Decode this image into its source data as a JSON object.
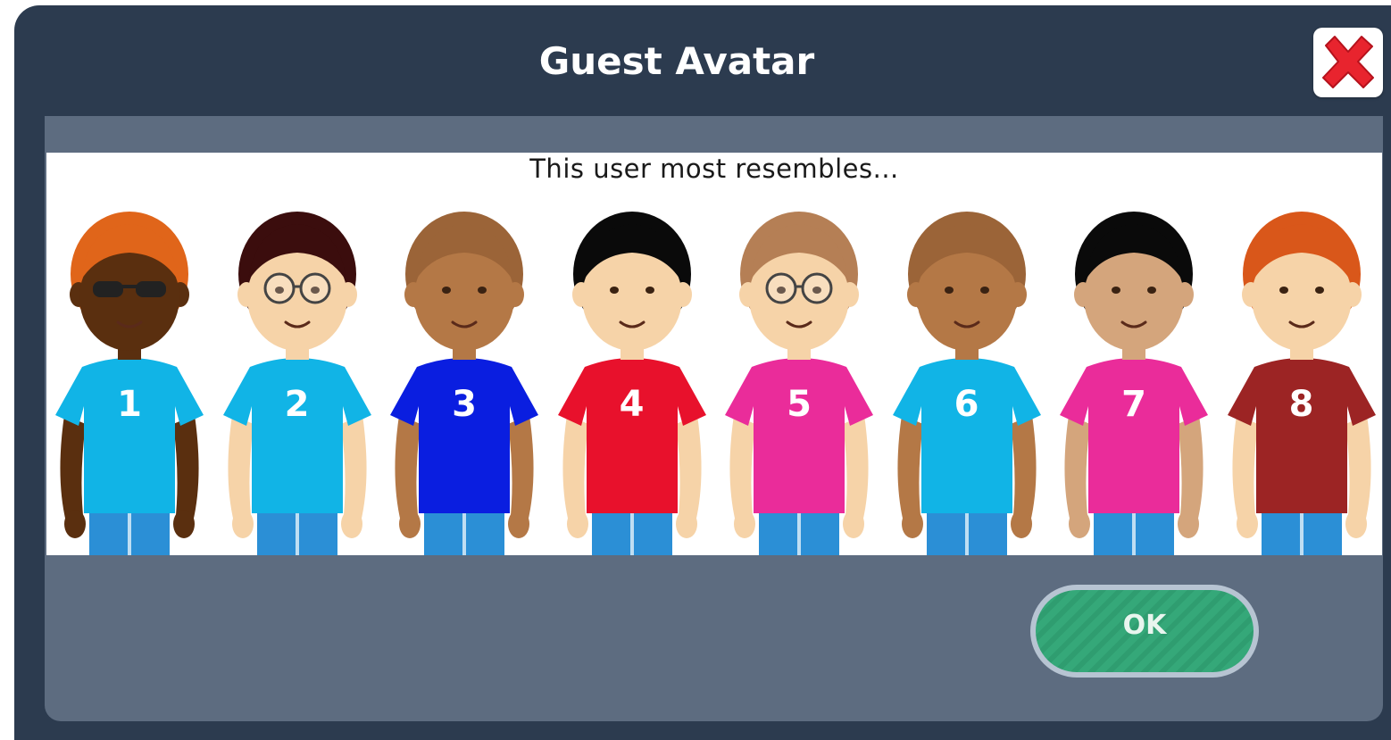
{
  "dialog": {
    "title": "Guest Avatar",
    "close_icon": "close-x-icon"
  },
  "prompt": "This user most resembles...",
  "avatars": [
    {
      "number": "1",
      "shirt": "#11b4e6",
      "skin": "#5a2f0f",
      "hair": "#e0651a",
      "glasses": "sunglasses"
    },
    {
      "number": "2",
      "shirt": "#11b4e6",
      "skin": "#f6d3a8",
      "hair": "#3b0d0d",
      "glasses": "round"
    },
    {
      "number": "3",
      "shirt": "#0a1ee0",
      "skin": "#b47846",
      "hair": "#9b6438",
      "glasses": "none"
    },
    {
      "number": "4",
      "shirt": "#e8112c",
      "skin": "#f6d3a8",
      "hair": "#0a0a0a",
      "glasses": "none"
    },
    {
      "number": "5",
      "shirt": "#ea2c9a",
      "skin": "#f6d3a8",
      "hair": "#b57f55",
      "glasses": "round"
    },
    {
      "number": "6",
      "shirt": "#11b4e6",
      "skin": "#b47846",
      "hair": "#9b6438",
      "glasses": "none"
    },
    {
      "number": "7",
      "shirt": "#ea2c9a",
      "skin": "#d4a57c",
      "hair": "#0a0a0a",
      "glasses": "none"
    },
    {
      "number": "8",
      "shirt": "#9c2424",
      "skin": "#f6d3a8",
      "hair": "#d9571a",
      "glasses": "none"
    }
  ],
  "ok_button": {
    "label": "OK"
  },
  "colors": {
    "frame": "#2c3b4f",
    "panel": "#5d6c80",
    "ok_green": "#35a879",
    "close_red": "#e8242e",
    "pants": "#2b8fd6"
  }
}
